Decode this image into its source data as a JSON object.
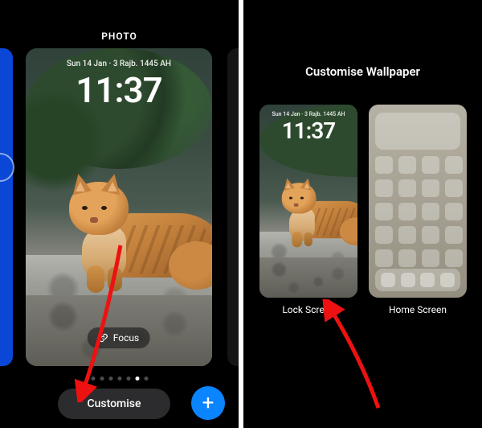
{
  "left": {
    "page_title": "PHOTO",
    "lock_date": "Sun 14 Jan · 3 Rajb. 1445 AH",
    "lock_time": "11:37",
    "focus_label": "Focus",
    "customise_label": "Customise",
    "dot_total": 7,
    "dot_active": 5
  },
  "right": {
    "title": "Customise Wallpaper",
    "lock_date": "Sun 14 Jan · 3 Rajb. 1445 AH",
    "lock_time": "11:37",
    "lock_label": "Lock Screen",
    "home_label": "Home Screen"
  },
  "colors": {
    "accent": "#0a84ff"
  }
}
